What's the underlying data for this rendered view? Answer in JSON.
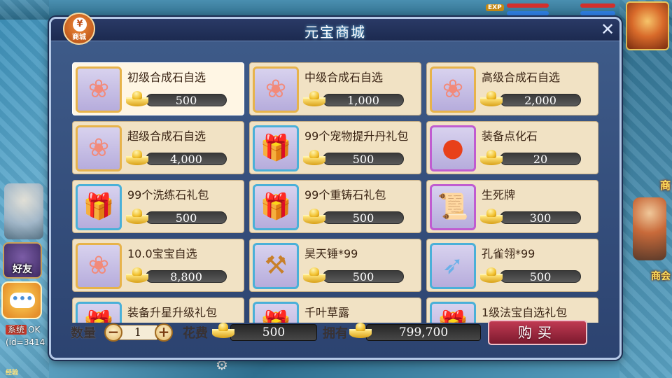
{
  "hud": {
    "exp_tag": "EXP",
    "shop_label": "商",
    "guild_label": "商会",
    "friend_label": "好友",
    "chat_dots": "•••",
    "system_tag": "系统",
    "system_text": "OK",
    "id_text": "(id=3414",
    "exp_bottom": "经验"
  },
  "shop_badge": {
    "coin": "¥",
    "label": "商城"
  },
  "window": {
    "title": "元宝商城",
    "close": "✕"
  },
  "items": [
    {
      "name": "初级合成石自选",
      "price": "500",
      "icon": "bag-icon",
      "glyph": "❀",
      "frame": "gold",
      "selected": true
    },
    {
      "name": "中级合成石自选",
      "price": "1,000",
      "icon": "bag-icon",
      "glyph": "❀",
      "frame": "gold"
    },
    {
      "name": "高级合成石自选",
      "price": "2,000",
      "icon": "bag-icon",
      "glyph": "❀",
      "frame": "gold"
    },
    {
      "name": "超级合成石自选",
      "price": "4,000",
      "icon": "bag-icon",
      "glyph": "❀",
      "frame": "gold"
    },
    {
      "name": "99个宠物提升丹礼包",
      "price": "500",
      "icon": "gift-box-icon",
      "glyph": "🎁",
      "frame": "blue"
    },
    {
      "name": "装备点化石",
      "price": "20",
      "icon": "fire-orb-icon",
      "glyph": "●",
      "frame": "purple"
    },
    {
      "name": "99个洗练石礼包",
      "price": "500",
      "icon": "gift-box-icon",
      "glyph": "🎁",
      "frame": "blue"
    },
    {
      "name": "99个重铸石礼包",
      "price": "500",
      "icon": "gift-box-icon",
      "glyph": "🎁",
      "frame": "blue"
    },
    {
      "name": "生死牌",
      "price": "300",
      "icon": "scroll-icon",
      "glyph": "📜",
      "frame": "purple"
    },
    {
      "name": "10.0宝宝自选",
      "price": "8,800",
      "icon": "bag-icon",
      "glyph": "❀",
      "frame": "gold"
    },
    {
      "name": "昊天锤*99",
      "price": "500",
      "icon": "hammer-icon",
      "glyph": "⚒",
      "frame": "blue"
    },
    {
      "name": "孔雀翎*99",
      "price": "500",
      "icon": "feather-icon",
      "glyph": "➶",
      "frame": "blue"
    },
    {
      "name": "装备升星升级礼包",
      "price": "",
      "icon": "gift-box-icon",
      "glyph": "🎁",
      "frame": "blue"
    },
    {
      "name": "千叶草露",
      "price": "",
      "icon": "gift-box-icon",
      "glyph": "🎁",
      "frame": "blue"
    },
    {
      "name": "1级法宝自选礼包",
      "price": "",
      "icon": "gift-box-icon",
      "glyph": "🎁",
      "frame": "blue"
    }
  ],
  "purchase": {
    "qty_label": "数量",
    "minus": "−",
    "qty": "1",
    "plus": "+",
    "cost_label": "花费",
    "total": "500",
    "own_label": "拥有",
    "owned": "799,700",
    "buy_label": "购买"
  },
  "colors": {
    "card_bg": "#f1e2c4",
    "window_bg": "#3f5c8a",
    "buy_button": "#a02a40"
  }
}
